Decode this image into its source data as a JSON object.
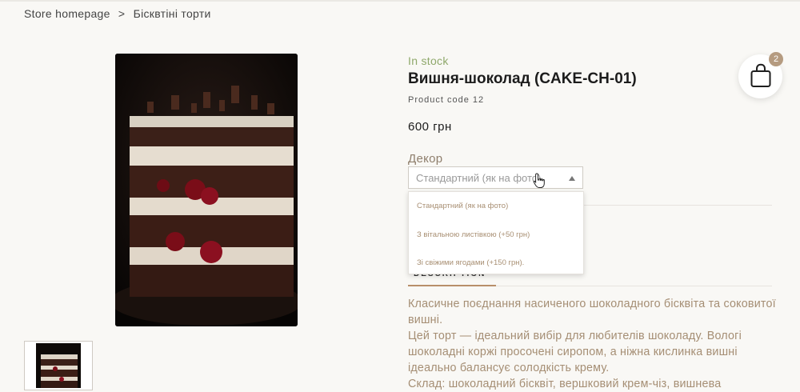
{
  "breadcrumb": {
    "home": "Store homepage",
    "separator": ">",
    "current": "Бісквтіні торти"
  },
  "product": {
    "stock": "In stock",
    "title": "Вишня-шоколад (CAKE-CH-01)",
    "code": "Product code 12",
    "price": "600  грн"
  },
  "decor": {
    "label": "Декор",
    "selected": "Стандартний (як на фото)",
    "options": [
      "Стандартний (як на фото)",
      "З вітальною листівкою (+50 грн)",
      "Зі свіжими ягодами (+150 грн)."
    ]
  },
  "tabs": {
    "description": "DESCRIPTION"
  },
  "description": [
    "Класичне поєднання насиченого шоколадного бісквіта та соковитої вишні.",
    "Цей торт — ідеальний вибір для любителів шоколаду. Вологі шоколадні коржі просочені сиропом, а ніжна кислинка вишні ідеально балансує солодкість крему.",
    "Склад: шоколадний бісквіт, вершковий крем-чіз, вишнева"
  ],
  "cart": {
    "count": "2",
    "icon": "shopping-bag-icon"
  },
  "colors": {
    "accent": "#b88f6a",
    "stock": "#8fa86b",
    "badge": "#b59b80"
  }
}
